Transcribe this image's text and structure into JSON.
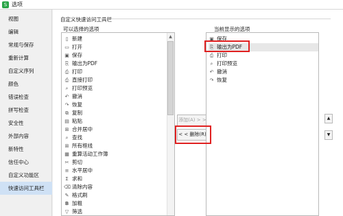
{
  "window": {
    "title": "选项"
  },
  "nav": {
    "items": [
      {
        "label": "视图"
      },
      {
        "label": "编辑"
      },
      {
        "label": "常规与保存"
      },
      {
        "label": "重新计算"
      },
      {
        "label": "自定义序列"
      },
      {
        "label": "颜色"
      },
      {
        "label": "错误检查"
      },
      {
        "label": "拼写检查"
      },
      {
        "label": "安全性"
      },
      {
        "label": "外部内容"
      },
      {
        "label": "新特性"
      },
      {
        "label": "信任中心"
      },
      {
        "label": "自定义功能区"
      },
      {
        "label": "快速访问工具栏"
      }
    ]
  },
  "main": {
    "section_title": "自定义快速访问工具栏",
    "available_label": "可以选择的选项",
    "current_label": "当前显示的选项",
    "add_button": "添加(A) > >",
    "delete_button": "< < 删除(R)",
    "available_items": [
      {
        "label": "新建",
        "icon": "new-doc-icon"
      },
      {
        "label": "打开",
        "icon": "open-folder-icon"
      },
      {
        "label": "保存",
        "icon": "save-icon"
      },
      {
        "label": "输出为PDF",
        "icon": "pdf-icon"
      },
      {
        "label": "打印",
        "icon": "print-icon"
      },
      {
        "label": "直接打印",
        "icon": "direct-print-icon"
      },
      {
        "label": "打印预览",
        "icon": "print-preview-icon"
      },
      {
        "label": "撤消",
        "icon": "undo-icon"
      },
      {
        "label": "恢复",
        "icon": "redo-icon"
      },
      {
        "label": "复制",
        "icon": "copy-icon"
      },
      {
        "label": "粘贴",
        "icon": "paste-icon"
      },
      {
        "label": "合并居中",
        "icon": "merge-center-icon"
      },
      {
        "label": "查找",
        "icon": "find-icon"
      },
      {
        "label": "所有框线",
        "icon": "all-borders-icon"
      },
      {
        "label": "重算活动工作簿",
        "icon": "recalc-icon"
      },
      {
        "label": "剪切",
        "icon": "cut-icon"
      },
      {
        "label": "水平居中",
        "icon": "center-align-icon"
      },
      {
        "label": "求和",
        "icon": "sum-icon"
      },
      {
        "label": "清除内容",
        "icon": "clear-icon"
      },
      {
        "label": "格式刷",
        "icon": "format-painter-icon"
      },
      {
        "label": "加粗",
        "icon": "bold-icon"
      },
      {
        "label": "筛选",
        "icon": "filter-icon"
      }
    ],
    "current_items": [
      {
        "label": "保存",
        "icon": "save-icon"
      },
      {
        "label": "输出为PDF",
        "icon": "pdf-icon"
      },
      {
        "label": "打印",
        "icon": "print-icon"
      },
      {
        "label": "打印预览",
        "icon": "print-preview-icon"
      },
      {
        "label": "撤消",
        "icon": "undo-icon"
      },
      {
        "label": "恢复",
        "icon": "redo-icon"
      }
    ]
  },
  "colors": {
    "highlight": "#e02020",
    "nav_active": "#cfe1f5",
    "app_icon": "#2aa447"
  }
}
